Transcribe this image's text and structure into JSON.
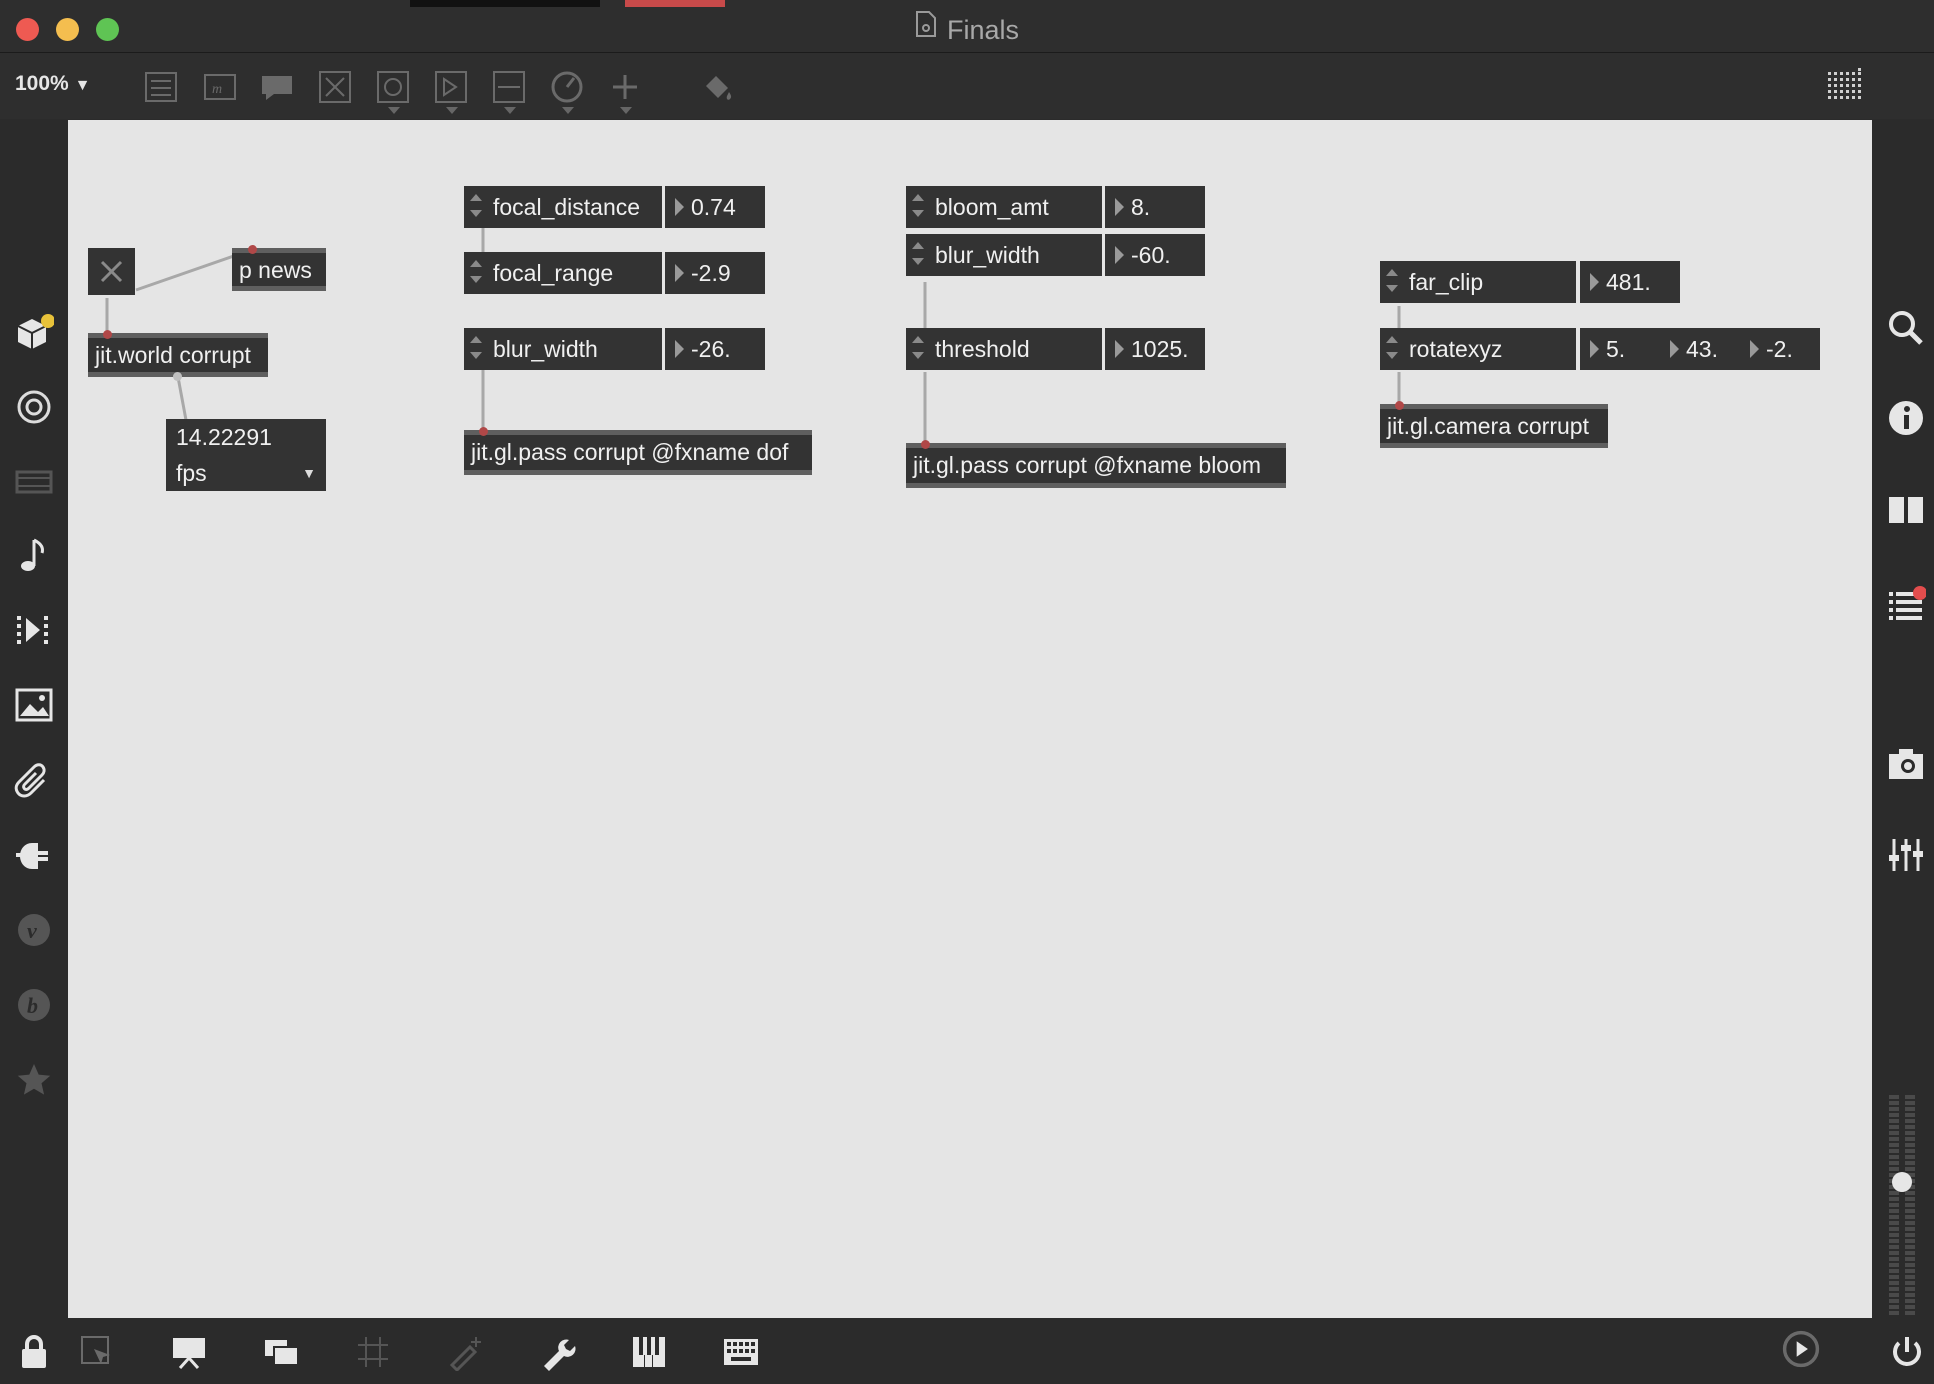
{
  "window": {
    "title": "Finals"
  },
  "toolbar": {
    "zoom": "100%"
  },
  "colors": {
    "canvas": "#e5e5e5",
    "object_bg": "#333333",
    "close": "#ee5a52",
    "minimize": "#f4be4f",
    "maximize": "#5fc454",
    "badge_yellow": "#e8c23a",
    "badge_red": "#e34d4d"
  },
  "patch": {
    "world": {
      "toggle_label": "",
      "p_news": "p news",
      "jit_world": "jit.world corrupt",
      "fps_value": "14.22291",
      "fps_menu": "fps"
    },
    "dof": {
      "focal_distance_label": "focal_distance",
      "focal_distance_value": "0.74",
      "focal_range_label": "focal_range",
      "focal_range_value": "-2.9",
      "blur_width_label": "blur_width",
      "blur_width_value": "-26.",
      "pass": "jit.gl.pass corrupt @fxname dof"
    },
    "bloom": {
      "bloom_amt_label": "bloom_amt",
      "bloom_amt_value": "8.",
      "blur_width_label": "blur_width",
      "blur_width_value": "-60.",
      "threshold_label": "threshold",
      "threshold_value": "1025.",
      "pass": "jit.gl.pass corrupt @fxname bloom"
    },
    "camera": {
      "far_clip_label": "far_clip",
      "far_clip_value": "481.",
      "rotatexyz_label": "rotatexyz",
      "rotate_x": "5.",
      "rotate_y": "43.",
      "rotate_z": "-2.",
      "object": "jit.gl.camera corrupt"
    }
  },
  "icons": {
    "toolbar": [
      "new-object-icon",
      "message-icon",
      "comment-icon",
      "button-icon",
      "toggle-icon",
      "number-icon",
      "slider-icon",
      "dial-icon",
      "add-icon",
      "paint-bucket-icon",
      "grid-icon"
    ],
    "left_sidebar": [
      "packages-icon",
      "target-icon",
      "video-icon",
      "music-note-icon",
      "sequence-icon",
      "image-icon",
      "paperclip-icon",
      "plugin-icon",
      "vimeo-icon",
      "b-icon",
      "star-icon"
    ],
    "right_sidebar": [
      "search-icon",
      "info-icon",
      "columns-icon",
      "list-icon",
      "camera-icon",
      "mixer-icon"
    ],
    "bottom": [
      "lock-icon",
      "select-icon",
      "presentation-icon",
      "windows-icon",
      "grid-icon",
      "brush-icon",
      "wrench-icon",
      "piano-icon",
      "keyboard-icon",
      "play-icon",
      "power-icon"
    ]
  }
}
